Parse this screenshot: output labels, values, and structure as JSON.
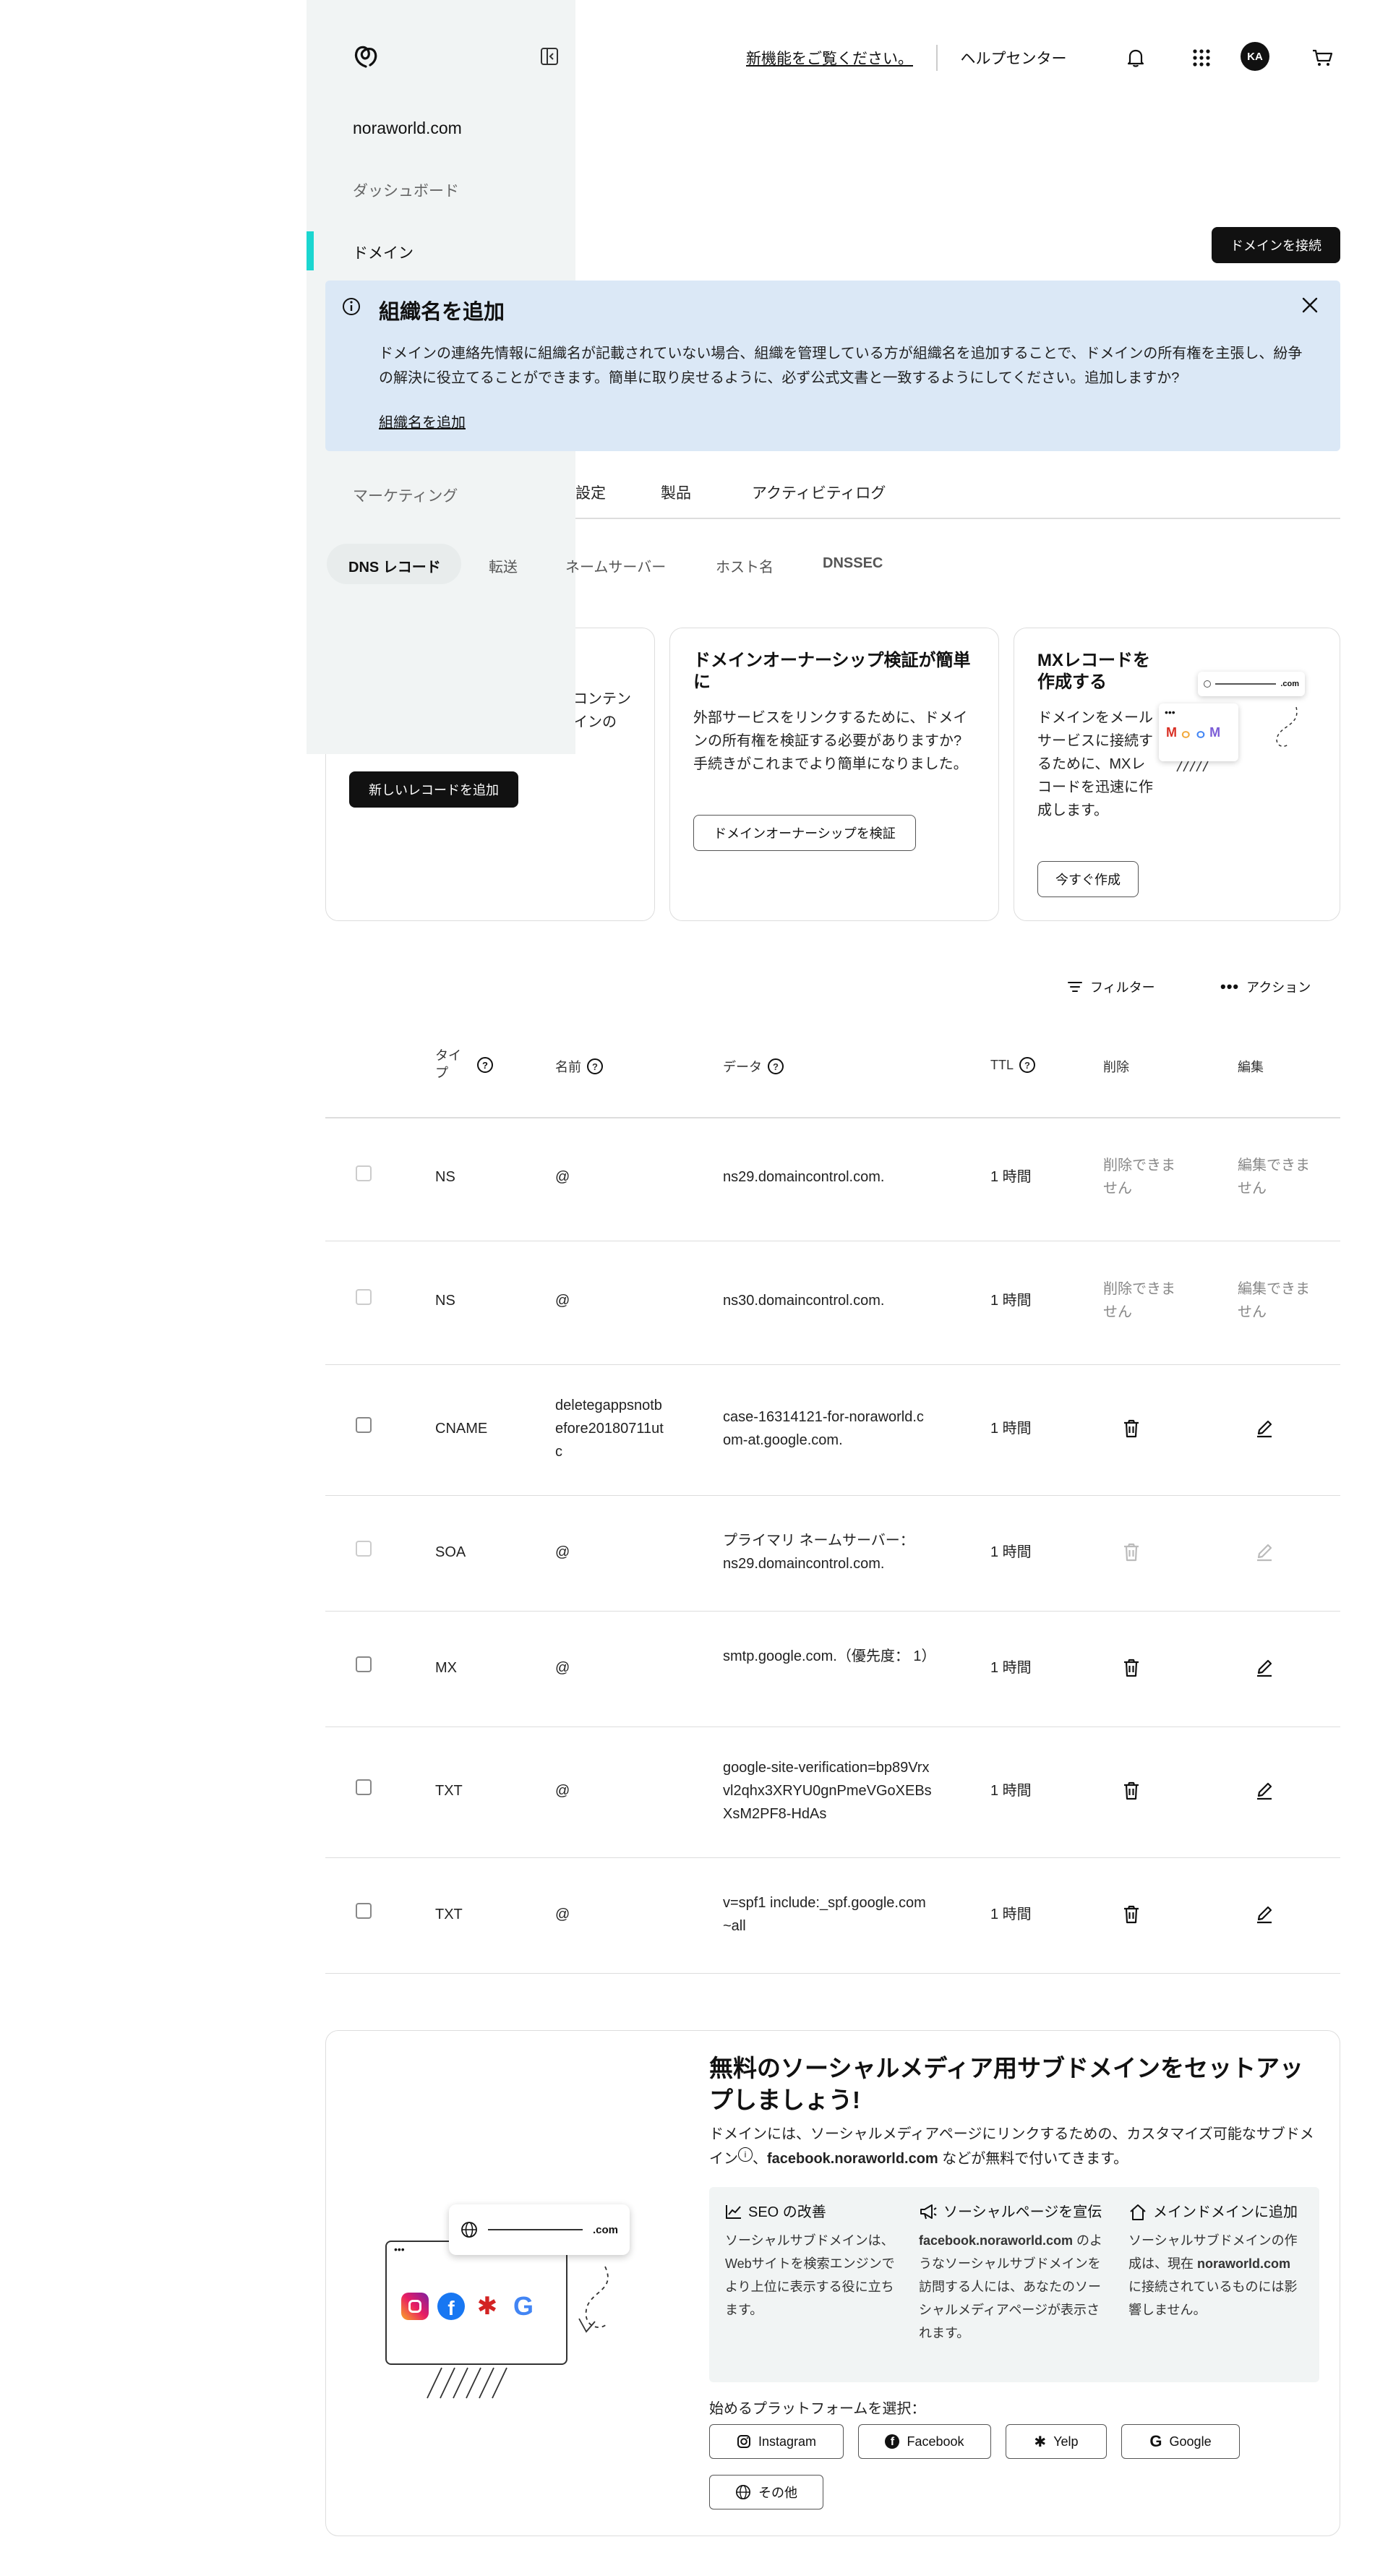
{
  "header": {
    "whats_new": "新機能をご覧ください。",
    "help_center": "ヘルプセンター",
    "avatar_initials": "KA"
  },
  "sidebar": {
    "domain_name": "noraworld.com",
    "items": [
      {
        "label": "ダッシュボード"
      },
      {
        "label": "ドメイン"
      },
      {
        "label": "マーケティング"
      }
    ]
  },
  "connect_domain_button": "ドメインを接続",
  "banner": {
    "title": "組織名を追加",
    "body": "ドメインの連絡先情報に組織名が記載されていない場合、組織を管理している方が組織名を追加することで、ドメインの所有権を主張し、紛争の解決に役立てることができます。簡単に取り戻せるように、必ず公式文書と一致するようにしてください。追加しますか?",
    "link": "組織名を追加"
  },
  "tabs": [
    "設定",
    "製品",
    "アクティビティログ"
  ],
  "subtabs": [
    "DNS レコード",
    "転送",
    "ネームサーバー",
    "ホスト名",
    "DNSSEC"
  ],
  "cards": {
    "card1": {
      "partial_line1": "コンテン",
      "partial_line2": "インの",
      "button": "新しいレコードを追加"
    },
    "card2": {
      "title": "ドメインオーナーシップ検証が簡単に",
      "body": "外部サービスをリンクするために、ドメインの所有権を検証する必要がありますか?手続きがこれまでより簡単になりました。",
      "button": "ドメインオーナーシップを検証"
    },
    "card3": {
      "title": "MXレコードを作成する",
      "body": "ドメインをメールサービスに接続するために、MXレコードを迅速に作成します。",
      "button": "今すぐ作成",
      "illustration_text": ".com"
    }
  },
  "toolbar": {
    "filter": "フィルター",
    "actions": "アクション"
  },
  "table": {
    "headers": {
      "type": "タイプ",
      "name": "名前",
      "data": "データ",
      "ttl": "TTL",
      "delete": "削除",
      "edit": "編集"
    },
    "rows": [
      {
        "type": "NS",
        "name": "@",
        "data": "ns29.domaincontrol.com.",
        "ttl": "1 時間",
        "delete": "削除できません",
        "edit": "編集できません"
      },
      {
        "type": "NS",
        "name": "@",
        "data": "ns30.domaincontrol.com.",
        "ttl": "1 時間",
        "delete": "削除できません",
        "edit": "編集できません"
      },
      {
        "type": "CNAME",
        "name": "deletegappsnotbefore20180711utc",
        "data": "case-16314121-for-noraworld.com-at.google.com.",
        "ttl": "1 時間"
      },
      {
        "type": "SOA",
        "name": "@",
        "data": "プライマリ ネームサーバー： ns29.domaincontrol.com.",
        "ttl": "1 時間"
      },
      {
        "type": "MX",
        "name": "@",
        "data": "smtp.google.com.（優先度： 1）",
        "ttl": "1 時間"
      },
      {
        "type": "TXT",
        "name": "@",
        "data": "google-site-verification=bp89Vrxvl2qhx3XRYU0gnPmeVGoXEBsXsM2PF8-HdAs",
        "ttl": "1 時間"
      },
      {
        "type": "TXT",
        "name": "@",
        "data": "v=spf1 include:_spf.google.com ~all",
        "ttl": "1 時間"
      }
    ]
  },
  "social": {
    "title": "無料のソーシャルメディア用サブドメインをセットアップしましょう!",
    "desc_part1": "ドメインには、ソーシャルメディアページにリンクするための、カスタマイズ可能なサブドメイン",
    "desc_part2": "、",
    "desc_bold": "facebook.noraworld.com",
    "desc_part3": " などが無料で付いてきます。",
    "illustration_text": ".com",
    "features": [
      {
        "title": "SEO の改善",
        "body": "ソーシャルサブドメインは、Webサイトを検索エンジンでより上位に表示する役に立ちます。"
      },
      {
        "title": "ソーシャルページを宣伝",
        "body_bold": "facebook.noraworld.com",
        "body": " のようなソーシャルサブドメインを訪問する人には、あなたのソーシャルメディアページが表示されます。"
      },
      {
        "title": "メインドメインに追加",
        "body_pre": "ソーシャルサブドメインの作成は、現在 ",
        "body_bold": "noraworld.com",
        "body": " に接続されているものには影響しません。"
      }
    ],
    "platform_label": "始めるプラットフォームを選択：",
    "platforms": [
      "Instagram",
      "Facebook",
      "Yelp",
      "Google",
      "その他"
    ]
  },
  "colors": {
    "accent_teal": "#1bd6d0",
    "banner_bg": "#dbe8f6",
    "sidebar_bg": "#f1f4f4",
    "dark": "#111111"
  }
}
